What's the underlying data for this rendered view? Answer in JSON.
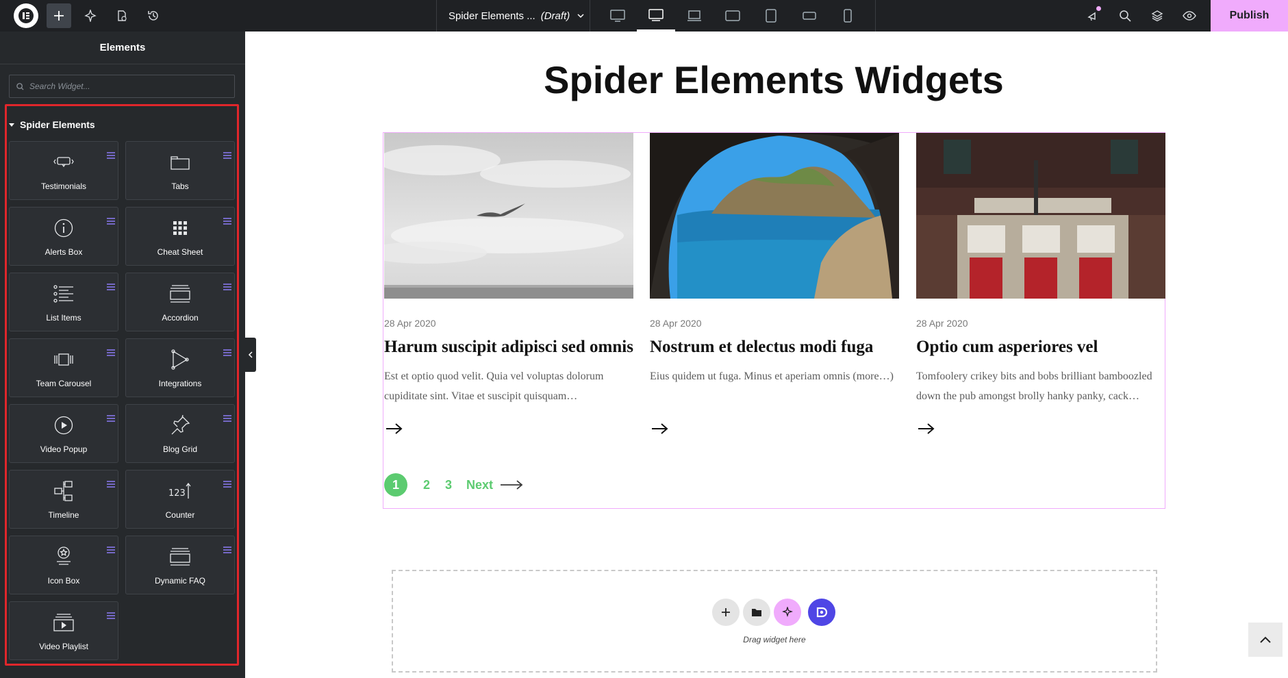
{
  "topbar": {
    "doc_title": "Spider Elements ...",
    "doc_status": "(Draft)",
    "publish_label": "Publish"
  },
  "panel": {
    "title": "Elements",
    "search_placeholder": "Search Widget...",
    "category": "Spider Elements",
    "widgets": [
      {
        "label": "Testimonials",
        "icon": "speech-bubble-icon"
      },
      {
        "label": "Tabs",
        "icon": "tabs-icon"
      },
      {
        "label": "Alerts Box",
        "icon": "info-circle-icon"
      },
      {
        "label": "Cheat Sheet",
        "icon": "grid-icon"
      },
      {
        "label": "List Items",
        "icon": "list-icon"
      },
      {
        "label": "Accordion",
        "icon": "accordion-icon"
      },
      {
        "label": "Team Carousel",
        "icon": "carousel-icon"
      },
      {
        "label": "Integrations",
        "icon": "integrations-icon"
      },
      {
        "label": "Video Popup",
        "icon": "play-circle-icon"
      },
      {
        "label": "Blog Grid",
        "icon": "pin-icon"
      },
      {
        "label": "Timeline",
        "icon": "timeline-icon"
      },
      {
        "label": "Counter",
        "icon": "counter-icon"
      },
      {
        "label": "Icon Box",
        "icon": "star-badge-icon"
      },
      {
        "label": "Dynamic FAQ",
        "icon": "faq-icon"
      },
      {
        "label": "Video Playlist",
        "icon": "video-playlist-icon"
      }
    ]
  },
  "canvas": {
    "heading": "Spider Elements Widgets",
    "posts": [
      {
        "date": "28 Apr 2020",
        "title": "Harum suscipit adipisci sed omnis",
        "excerpt": "Est et optio quod velit. Quia vel voluptas dolorum cupiditate sint. Vitae et suscipit quisquam…"
      },
      {
        "date": "28 Apr 2020",
        "title": "Nostrum et delectus modi fuga",
        "excerpt": "Eius quidem ut fuga. Minus et aperiam omnis (more…)"
      },
      {
        "date": "28 Apr 2020",
        "title": "Optio cum asperiores vel",
        "excerpt": "Tomfoolery crikey bits and bobs brilliant bamboozled down the pub amongst brolly hanky panky, cack…"
      }
    ],
    "pagination": {
      "current": "1",
      "pages": [
        "2",
        "3"
      ],
      "next": "Next"
    },
    "drop_text": "Drag widget here"
  },
  "colors": {
    "accent_pink": "#f0abfc",
    "pagination_green": "#5ccb70",
    "panel_bg": "#26292c",
    "highlight_red": "#e0262b"
  }
}
